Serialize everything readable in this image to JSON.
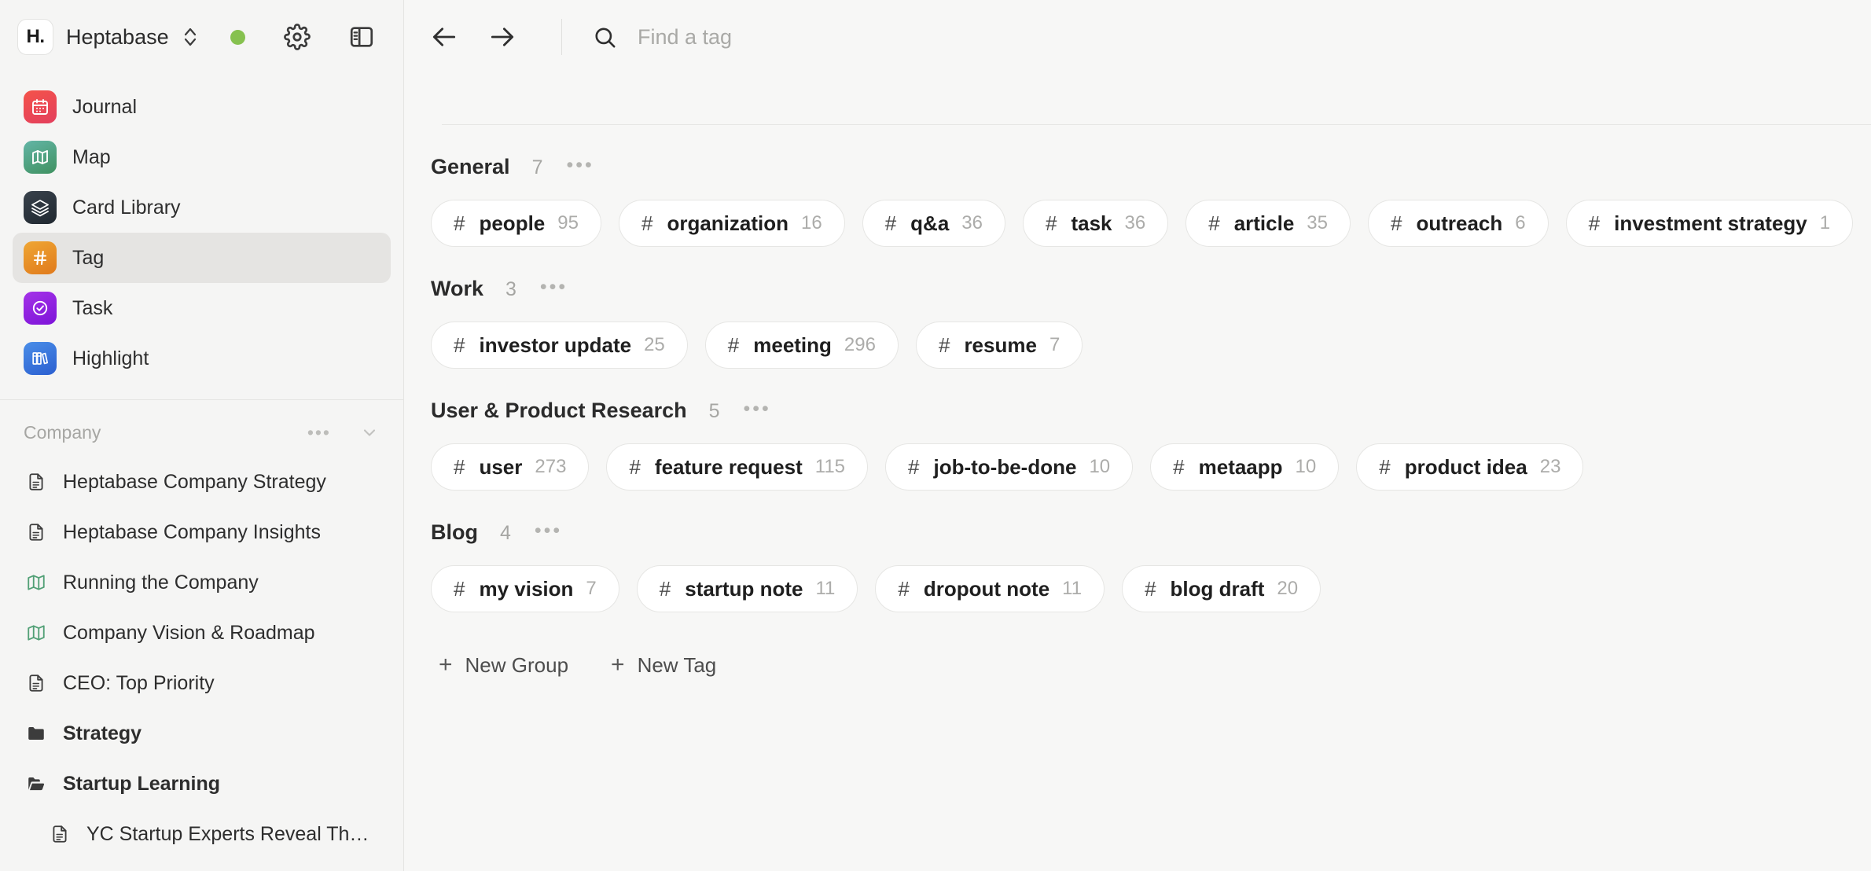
{
  "workspace": {
    "logo_text": "H.",
    "name": "Heptabase",
    "logo_icon": "heptabase-logo-icon",
    "switcher_icon": "chevron-up-down-icon",
    "status_icon": "sync-status-dot",
    "settings_icon": "gear-icon",
    "panel_icon": "toggle-sidebar-icon"
  },
  "sidebar": {
    "nav": [
      {
        "label": "Journal",
        "icon": "calendar-icon",
        "icon_class": "ico-journal",
        "active": false
      },
      {
        "label": "Map",
        "icon": "map-icon",
        "icon_class": "ico-map",
        "active": false
      },
      {
        "label": "Card Library",
        "icon": "layers-icon",
        "icon_class": "ico-card",
        "active": false
      },
      {
        "label": "Tag",
        "icon": "hash-icon",
        "icon_class": "ico-tag",
        "active": true
      },
      {
        "label": "Task",
        "icon": "check-circle-icon",
        "icon_class": "ico-task",
        "active": false
      },
      {
        "label": "Highlight",
        "icon": "books-icon",
        "icon_class": "ico-highlight",
        "active": false
      }
    ],
    "section": {
      "title": "Company",
      "more_icon": "ellipsis-icon",
      "collapse_icon": "chevron-down-icon"
    },
    "documents": [
      {
        "label": "Heptabase Company Strategy",
        "icon": "document-icon",
        "indent": false,
        "bold": false
      },
      {
        "label": "Heptabase Company Insights",
        "icon": "document-icon",
        "indent": false,
        "bold": false
      },
      {
        "label": "Running the Company",
        "icon": "whiteboard-map-icon",
        "indent": false,
        "bold": false
      },
      {
        "label": "Company Vision & Roadmap",
        "icon": "whiteboard-map-icon",
        "indent": false,
        "bold": false
      },
      {
        "label": "CEO: Top Priority",
        "icon": "document-icon",
        "indent": false,
        "bold": false
      },
      {
        "label": "Strategy",
        "icon": "folder-closed-icon",
        "indent": false,
        "bold": true
      },
      {
        "label": "Startup Learning",
        "icon": "folder-open-icon",
        "indent": false,
        "bold": true
      },
      {
        "label": "YC Startup Experts Reveal Thei…",
        "icon": "document-icon",
        "indent": true,
        "bold": false
      }
    ]
  },
  "topbar": {
    "back_icon": "arrow-left-icon",
    "forward_icon": "arrow-right-icon",
    "search_icon": "search-icon",
    "search_value": "",
    "search_placeholder": "Find a tag"
  },
  "tag_groups": [
    {
      "name": "General",
      "count": "7",
      "more_icon": "ellipsis-icon",
      "tags": [
        {
          "hash": "#",
          "name": "people",
          "count": "95"
        },
        {
          "hash": "#",
          "name": "organization",
          "count": "16"
        },
        {
          "hash": "#",
          "name": "q&a",
          "count": "36"
        },
        {
          "hash": "#",
          "name": "task",
          "count": "36"
        },
        {
          "hash": "#",
          "name": "article",
          "count": "35"
        },
        {
          "hash": "#",
          "name": "outreach",
          "count": "6"
        },
        {
          "hash": "#",
          "name": "investment strategy",
          "count": "1"
        }
      ]
    },
    {
      "name": "Work",
      "count": "3",
      "more_icon": "ellipsis-icon",
      "tags": [
        {
          "hash": "#",
          "name": "investor update",
          "count": "25"
        },
        {
          "hash": "#",
          "name": "meeting",
          "count": "296"
        },
        {
          "hash": "#",
          "name": "resume",
          "count": "7"
        }
      ]
    },
    {
      "name": "User & Product Research",
      "count": "5",
      "more_icon": "ellipsis-icon",
      "tags": [
        {
          "hash": "#",
          "name": "user",
          "count": "273"
        },
        {
          "hash": "#",
          "name": "feature request",
          "count": "115"
        },
        {
          "hash": "#",
          "name": "job-to-be-done",
          "count": "10"
        },
        {
          "hash": "#",
          "name": "metaapp",
          "count": "10"
        },
        {
          "hash": "#",
          "name": "product idea",
          "count": "23"
        }
      ]
    },
    {
      "name": "Blog",
      "count": "4",
      "more_icon": "ellipsis-icon",
      "tags": [
        {
          "hash": "#",
          "name": "my vision",
          "count": "7"
        },
        {
          "hash": "#",
          "name": "startup note",
          "count": "11"
        },
        {
          "hash": "#",
          "name": "dropout note",
          "count": "11"
        },
        {
          "hash": "#",
          "name": "blog draft",
          "count": "20"
        }
      ]
    }
  ],
  "footer_actions": [
    {
      "label": "New Group",
      "plus": "+",
      "icon": "plus-icon"
    },
    {
      "label": "New Tag",
      "plus": "+",
      "icon": "plus-icon"
    }
  ],
  "colors": {
    "sidebar_bg": "#f5f5f4",
    "main_bg": "#f7f7f6",
    "active_item": "#e5e4e2",
    "pill_bg": "#ffffff",
    "pill_border": "#e6e6e4",
    "status_green": "#86c14f",
    "muted_text": "#a6a6a3"
  }
}
